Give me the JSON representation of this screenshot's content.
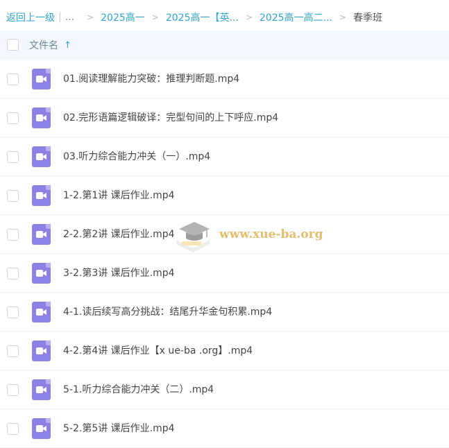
{
  "breadcrumb": {
    "back": "返回上一级",
    "ellipsis": "...",
    "items": [
      "2025高一",
      "2025高一【英...",
      "2025高一高二...",
      "春季班"
    ]
  },
  "header": {
    "column_label": "文件名",
    "sort_icon": "arrow-up-icon"
  },
  "files": [
    {
      "name": "01.阅读理解能力突破：推理判断题.mp4",
      "icon": "video-file-icon"
    },
    {
      "name": "02.完形语篇逻辑破译：完型句间的上下呼应.mp4",
      "icon": "video-file-icon"
    },
    {
      "name": "03.听力综合能力冲关（一）.mp4",
      "icon": "video-file-icon"
    },
    {
      "name": "1-2.第1讲 课后作业.mp4",
      "icon": "video-file-icon"
    },
    {
      "name": "2-2.第2讲 课后作业.mp4",
      "icon": "video-file-icon"
    },
    {
      "name": "3-2.第3讲 课后作业.mp4",
      "icon": "video-file-icon"
    },
    {
      "name": "4-1.读后续写高分挑战：结尾升华金句积累.mp4",
      "icon": "video-file-icon"
    },
    {
      "name": "4-2.第4讲 课后作业【x ue-ba .org】.mp4",
      "icon": "video-file-icon"
    },
    {
      "name": "5-1.听力综合能力冲关（二）.mp4",
      "icon": "video-file-icon"
    },
    {
      "name": "5-2.第5讲 课后作业.mp4",
      "icon": "video-file-icon"
    }
  ],
  "watermark": {
    "text": "www.xue-ba.org"
  },
  "colors": {
    "link": "#2fa4cf",
    "icon_purple": "#8a82e6",
    "header_bg": "#f2f8fd"
  }
}
